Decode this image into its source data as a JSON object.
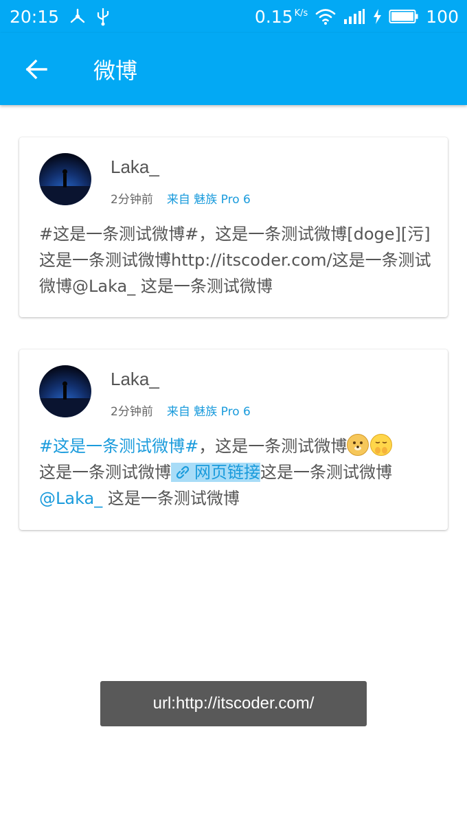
{
  "status_bar": {
    "time": "20:15",
    "net_speed": "0.15",
    "net_unit": "K/s",
    "battery": "100"
  },
  "app_bar": {
    "title": "微博",
    "back_icon": "arrow-left-icon"
  },
  "posts": [
    {
      "username": "Laka_",
      "time_ago": "2分钟前",
      "source": "来自 魅族 Pro 6",
      "content": "#这是一条测试微博#，这是一条测试微博[doge][污]这是一条测试微博http://itscoder.com/这是一条测试微博@Laka_ 这是一条测试微博"
    },
    {
      "username": "Laka_",
      "time_ago": "2分钟前",
      "source": "来自 魅族 Pro 6",
      "segments": {
        "topic": "#这是一条测试微博#",
        "text1": "，这是一条测试微博",
        "text2": "这是一条测试微博",
        "link_label": "网页链接",
        "text3": "这是一条测试微博",
        "mention": "@Laka_",
        "text4": " 这是一条测试微博"
      },
      "emojis": [
        "doge-emoji",
        "wu-emoji"
      ]
    }
  ],
  "toast": {
    "text": "url:http://itscoder.com/"
  },
  "colors": {
    "primary": "#03a9f4",
    "link": "#1a9bdc",
    "link_highlight": "#a8dcf7",
    "toast_bg": "#595959"
  }
}
